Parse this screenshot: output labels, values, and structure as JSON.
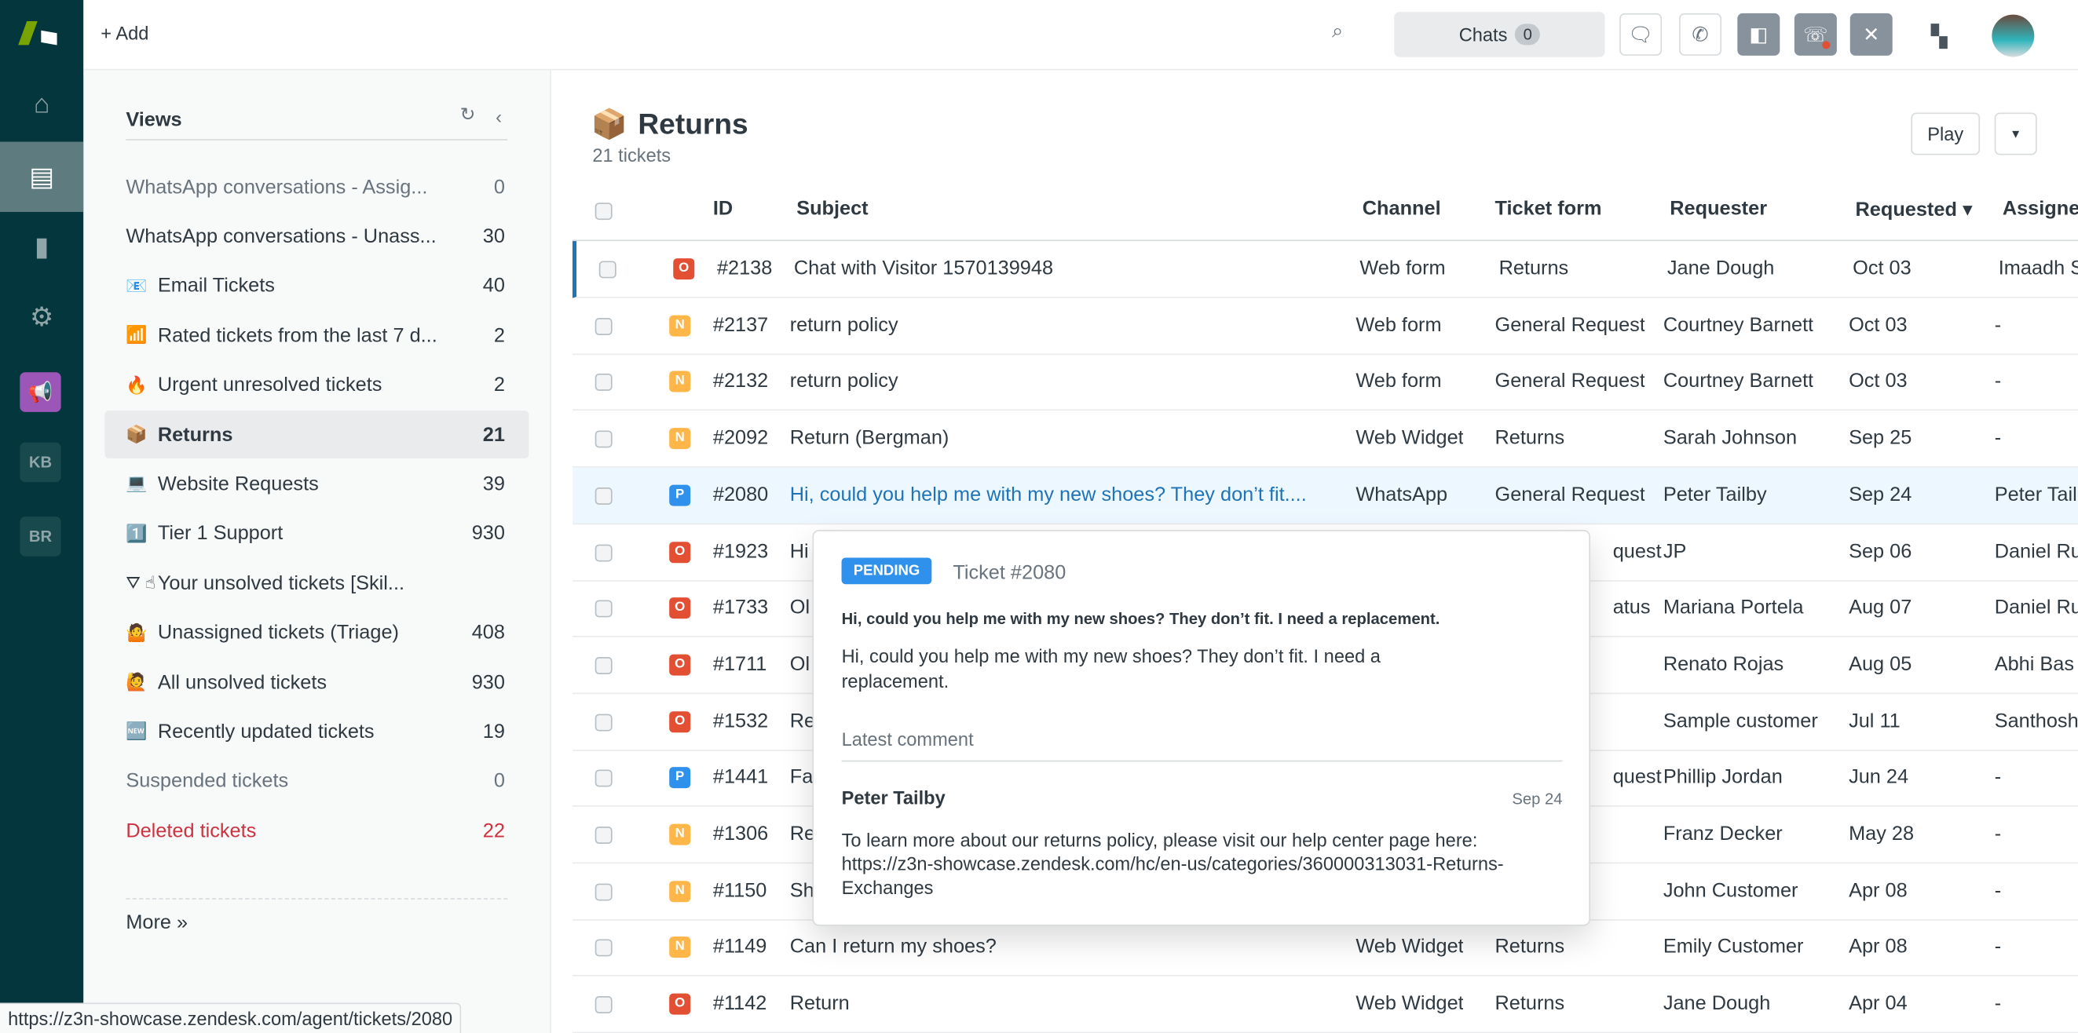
{
  "colors": {
    "nav_bg": "#03363d",
    "accent": "#1f73b7",
    "open": "#e34f32",
    "new": "#ffb648",
    "pending": "#3091ec",
    "deleted": "#cc3340"
  },
  "topbar": {
    "add_label": "Add",
    "chats_label": "Chats",
    "chats_count": "0"
  },
  "nav": {
    "kb": "KB",
    "br": "BR"
  },
  "views": {
    "title": "Views",
    "more": "More »",
    "items": [
      {
        "icon": "",
        "label": "WhatsApp conversations - Assig...",
        "count": "0",
        "style": "muted"
      },
      {
        "icon": "",
        "label": "WhatsApp conversations - Unass...",
        "count": "30",
        "style": ""
      },
      {
        "icon": "📧",
        "label": "Email Tickets",
        "count": "40",
        "style": ""
      },
      {
        "icon": "📶",
        "label": "Rated tickets from the last 7 d...",
        "count": "2",
        "style": ""
      },
      {
        "icon": "🔥",
        "label": "Urgent unresolved tickets",
        "count": "2",
        "style": ""
      },
      {
        "icon": "📦",
        "label": "Returns",
        "count": "21",
        "style": "sel"
      },
      {
        "icon": "💻",
        "label": "Website Requests",
        "count": "39",
        "style": ""
      },
      {
        "icon": "1️⃣",
        "label": "Tier 1 Support",
        "count": "930",
        "style": ""
      },
      {
        "icon": "⛛ ☝",
        "label": "Your unsolved tickets [Skil...",
        "count": "",
        "style": ""
      },
      {
        "icon": "🤷",
        "label": "Unassigned tickets (Triage)",
        "count": "408",
        "style": ""
      },
      {
        "icon": "🙋",
        "label": "All unsolved tickets",
        "count": "930",
        "style": ""
      },
      {
        "icon": "🆕",
        "label": "Recently updated tickets",
        "count": "19",
        "style": ""
      },
      {
        "icon": "",
        "label": "Suspended tickets",
        "count": "0",
        "style": "muted"
      },
      {
        "icon": "",
        "label": "Deleted tickets",
        "count": "22",
        "style": "del"
      }
    ]
  },
  "main": {
    "title_icon": "📦",
    "title": "Returns",
    "subtitle": "21 tickets",
    "play": "Play",
    "columns": {
      "id": "ID",
      "subject": "Subject",
      "channel": "Channel",
      "form": "Ticket form",
      "requester": "Requester",
      "requested": "Requested ▾",
      "assignee": "Assignee"
    },
    "rows": [
      {
        "status": "O",
        "id": "#2138",
        "subject": "Chat with Visitor 1570139948",
        "channel": "Web form",
        "form": "Returns",
        "requester": "Jane Dough",
        "requested": "Oct 03",
        "assignee": "Imaadh S"
      },
      {
        "status": "N",
        "id": "#2137",
        "subject": "return policy",
        "channel": "Web form",
        "form": "General Request",
        "requester": "Courtney Barnett",
        "requested": "Oct 03",
        "assignee": "-"
      },
      {
        "status": "N",
        "id": "#2132",
        "subject": "return policy",
        "channel": "Web form",
        "form": "General Request",
        "requester": "Courtney Barnett",
        "requested": "Oct 03",
        "assignee": "-"
      },
      {
        "status": "N",
        "id": "#2092",
        "subject": "Return (Bergman)",
        "channel": "Web Widget",
        "form": "Returns",
        "requester": "Sarah Johnson",
        "requested": "Sep 25",
        "assignee": "-"
      },
      {
        "status": "P",
        "id": "#2080",
        "subject": "Hi, could you help me with my new shoes? They don’t fit....",
        "channel": "WhatsApp",
        "form": "General Request",
        "requester": "Peter Tailby",
        "requested": "Sep 24",
        "assignee": "Peter Tail"
      },
      {
        "status": "O",
        "id": "#1923",
        "subject": "Hi",
        "channel": "",
        "form": "quest",
        "requester": "JP",
        "requested": "Sep 06",
        "assignee": "Daniel Ru"
      },
      {
        "status": "O",
        "id": "#1733",
        "subject": "Ol",
        "channel": "",
        "form": "atus",
        "requester": "Mariana Portela",
        "requested": "Aug 07",
        "assignee": "Daniel Ru"
      },
      {
        "status": "O",
        "id": "#1711",
        "subject": "Ol",
        "channel": "",
        "form": "",
        "requester": "Renato Rojas",
        "requested": "Aug 05",
        "assignee": "Abhi Bas"
      },
      {
        "status": "O",
        "id": "#1532",
        "subject": "Re",
        "channel": "",
        "form": "",
        "requester": "Sample customer",
        "requested": "Jul 11",
        "assignee": "Santhosh"
      },
      {
        "status": "P",
        "id": "#1441",
        "subject": "Fa",
        "channel": "",
        "form": "quest",
        "requester": "Phillip Jordan",
        "requested": "Jun 24",
        "assignee": "-"
      },
      {
        "status": "N",
        "id": "#1306",
        "subject": "Re",
        "channel": "",
        "form": "",
        "requester": "Franz Decker",
        "requested": "May 28",
        "assignee": "-"
      },
      {
        "status": "N",
        "id": "#1150",
        "subject": "Sh",
        "channel": "",
        "form": "",
        "requester": "John Customer",
        "requested": "Apr 08",
        "assignee": "-"
      },
      {
        "status": "N",
        "id": "#1149",
        "subject": "Can I return my shoes?",
        "channel": "Web Widget",
        "form": "Returns",
        "requester": "Emily Customer",
        "requested": "Apr 08",
        "assignee": "-"
      },
      {
        "status": "O",
        "id": "#1142",
        "subject": "Return",
        "channel": "Web Widget",
        "form": "Returns",
        "requester": "Jane Dough",
        "requested": "Apr 04",
        "assignee": "-"
      }
    ]
  },
  "popover": {
    "status": "PENDING",
    "ticket": "Ticket #2080",
    "subject": "Hi, could you help me with my new shoes? They don’t fit. I need a replacement.",
    "description": "Hi, could you help me with my new shoes? They don’t fit. I need a replacement.",
    "latest_label": "Latest comment",
    "author": "Peter Tailby",
    "date": "Sep 24",
    "comment": "To learn more about our returns policy, please visit our help center page here: https://z3n-showcase.zendesk.com/hc/en-us/categories/360000313031-Returns-Exchanges"
  },
  "statusbar": {
    "url": "https://z3n-showcase.zendesk.com/agent/tickets/2080"
  }
}
